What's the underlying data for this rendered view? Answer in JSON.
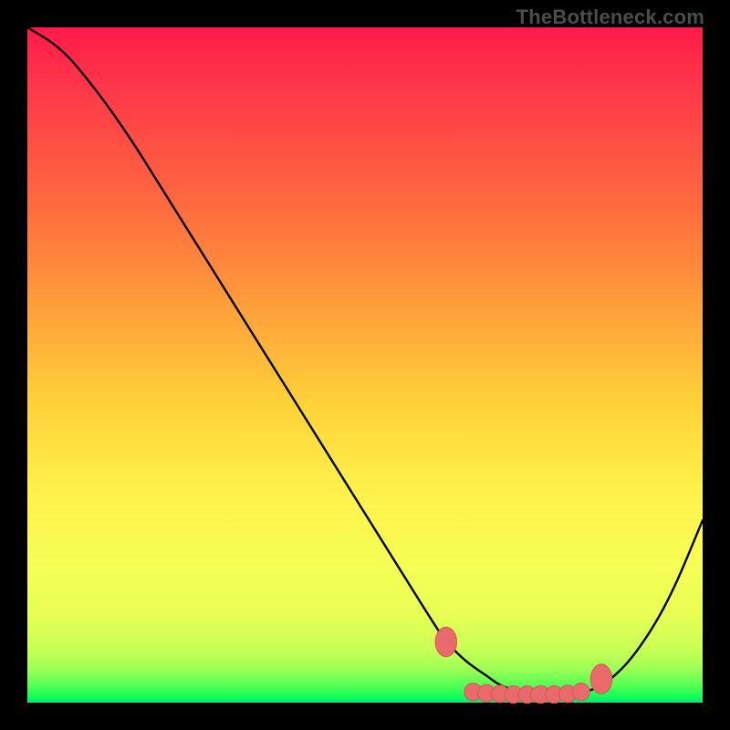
{
  "watermark": "TheBottleneck.com",
  "colors": {
    "background": "#000000",
    "curve": "#000000",
    "marker_fill": "#e86a6a",
    "marker_stroke": "#d94f4f"
  },
  "chart_data": {
    "type": "line",
    "title": "",
    "xlabel": "",
    "ylabel": "",
    "xlim": [
      0,
      100
    ],
    "ylim": [
      0,
      100
    ],
    "series": [
      {
        "name": "curve",
        "x": [
          0,
          5,
          10,
          15,
          20,
          25,
          30,
          35,
          40,
          45,
          50,
          55,
          60,
          62,
          65,
          68,
          70,
          73,
          76,
          80,
          83,
          86,
          90,
          95,
          100
        ],
        "values": [
          100,
          97,
          91,
          84,
          76,
          68,
          60,
          52,
          44,
          36,
          28,
          20,
          12,
          9,
          6,
          4,
          2.5,
          1.6,
          1.2,
          1.2,
          1.6,
          3,
          7,
          15,
          27
        ]
      }
    ],
    "markers": [
      {
        "x": 62,
        "y": 9,
        "rx": 1.6,
        "ry": 2.2
      },
      {
        "x": 66,
        "y": 1.6,
        "rx": 1.3,
        "ry": 1.3
      },
      {
        "x": 68,
        "y": 1.4,
        "rx": 1.3,
        "ry": 1.3
      },
      {
        "x": 70,
        "y": 1.3,
        "rx": 1.3,
        "ry": 1.3
      },
      {
        "x": 72,
        "y": 1.2,
        "rx": 1.3,
        "ry": 1.3
      },
      {
        "x": 74,
        "y": 1.2,
        "rx": 1.3,
        "ry": 1.3
      },
      {
        "x": 76,
        "y": 1.2,
        "rx": 1.5,
        "ry": 1.3
      },
      {
        "x": 78,
        "y": 1.2,
        "rx": 1.3,
        "ry": 1.3
      },
      {
        "x": 80,
        "y": 1.3,
        "rx": 1.3,
        "ry": 1.3
      },
      {
        "x": 82,
        "y": 1.6,
        "rx": 1.3,
        "ry": 1.3
      },
      {
        "x": 85,
        "y": 3.5,
        "rx": 1.6,
        "ry": 2.2
      }
    ]
  }
}
